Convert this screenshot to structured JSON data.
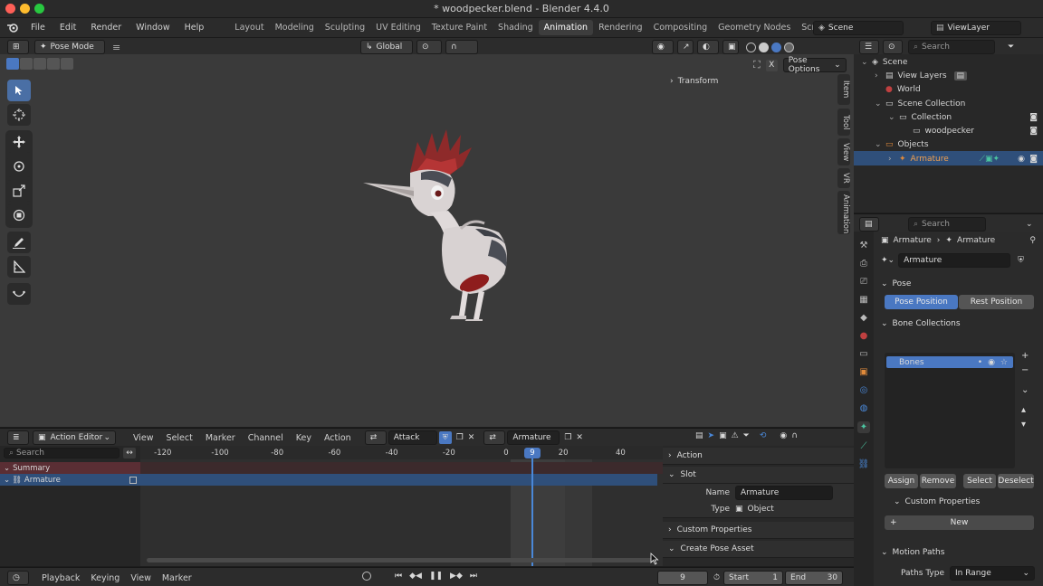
{
  "window": {
    "title": "* woodpecker.blend - Blender 4.4.0"
  },
  "topmenu": {
    "items": [
      "File",
      "Edit",
      "Render",
      "Window",
      "Help"
    ],
    "workspaces": [
      "Layout",
      "Modeling",
      "Sculpting",
      "UV Editing",
      "Texture Paint",
      "Shading",
      "Animation",
      "Rendering",
      "Compositing",
      "Geometry Nodes",
      "Scripting"
    ],
    "active_workspace": "Animation",
    "scene": "Scene",
    "view_layer": "ViewLayer"
  },
  "viewport": {
    "mode": "Pose Mode",
    "orientation": "Global",
    "pose_options": "Pose Options",
    "transform_panel": "Transform",
    "side_tabs": [
      "Item",
      "Tool",
      "View",
      "VR",
      "Animation"
    ]
  },
  "action_editor": {
    "editor_type": "Action Editor",
    "menus": [
      "View",
      "Select",
      "Marker",
      "Channel",
      "Key",
      "Action"
    ],
    "action": "Attack",
    "slot_object": "Armature",
    "search_placeholder": "Search",
    "ruler": [
      "-120",
      "-100",
      "-80",
      "-60",
      "-40",
      "-20",
      "0",
      "20",
      "40"
    ],
    "current_frame_label": "9",
    "channels": [
      "Summary",
      "Armature"
    ],
    "panels": {
      "action": "Action",
      "slot": "Slot",
      "name_label": "Name",
      "name_value": "Armature",
      "type_label": "Type",
      "type_value": "Object",
      "custom_props": "Custom Properties",
      "create_pose_asset": "Create Pose Asset"
    }
  },
  "timeline": {
    "menus": [
      "Playback",
      "Keying",
      "View",
      "Marker"
    ],
    "current_frame": "9",
    "start_label": "Start",
    "start": "1",
    "end_label": "End",
    "end": "30"
  },
  "outliner": {
    "search_placeholder": "Search",
    "rows": [
      {
        "label": "Scene",
        "indent": 0
      },
      {
        "label": "View Layers",
        "indent": 1
      },
      {
        "label": "World",
        "indent": 1
      },
      {
        "label": "Scene Collection",
        "indent": 1
      },
      {
        "label": "Collection",
        "indent": 2
      },
      {
        "label": "woodpecker",
        "indent": 3
      },
      {
        "label": "Objects",
        "indent": 1
      },
      {
        "label": "Armature",
        "indent": 2
      }
    ]
  },
  "properties": {
    "search_placeholder": "Search",
    "breadcrumb": [
      "Armature",
      "Armature"
    ],
    "datablock": "Armature",
    "pose_section": "Pose",
    "pose_position": "Pose Position",
    "rest_position": "Rest Position",
    "bone_collections": "Bone Collections",
    "bones_item": "Bones",
    "assign": "Assign",
    "remove": "Remove",
    "select": "Select",
    "deselect": "Deselect",
    "custom_properties": "Custom Properties",
    "new": "New",
    "motion_paths": "Motion Paths",
    "paths_type_label": "Paths Type",
    "paths_type_value": "In Range"
  },
  "colors": {
    "accent": "#4a78c2",
    "selected_row": "#2f4f7a",
    "playhead": "#4a88d8"
  }
}
